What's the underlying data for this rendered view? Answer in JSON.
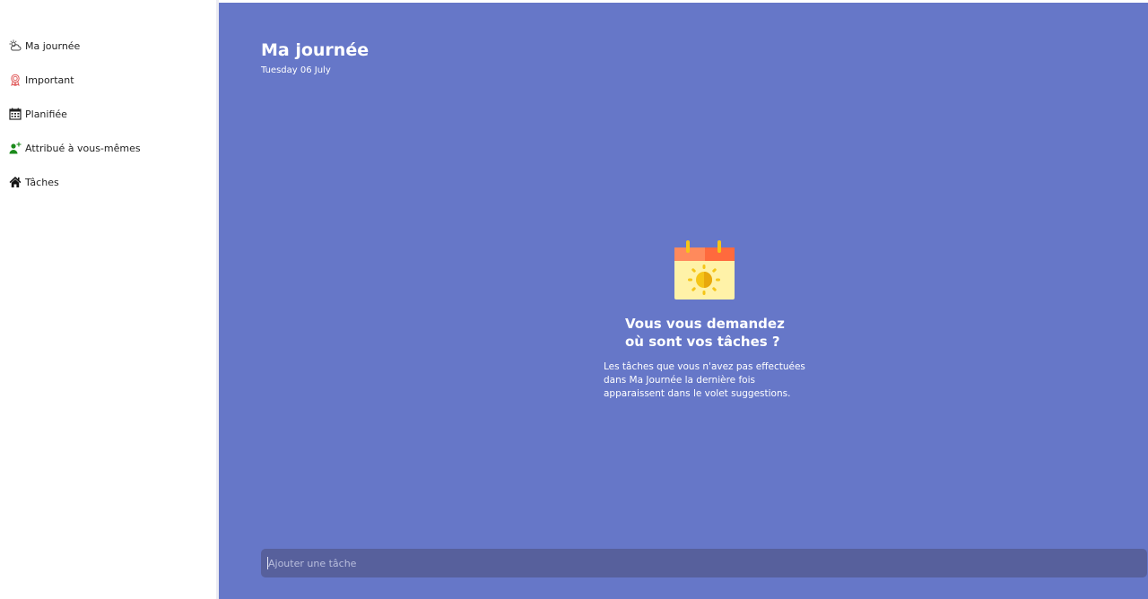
{
  "sidebar": {
    "items": [
      {
        "label": "Ma journée",
        "icon": "sun-cloud-icon",
        "icon_color": "#444444"
      },
      {
        "label": "Important",
        "icon": "award-icon",
        "icon_color": "#e05a5a"
      },
      {
        "label": "Planifiée",
        "icon": "calendar-icon",
        "icon_color": "#222222"
      },
      {
        "label": "Attribué à vous-mêmes",
        "icon": "person-add-icon",
        "icon_color": "#1a8a1a"
      },
      {
        "label": "Tâches",
        "icon": "home-icon",
        "icon_color": "#111111"
      }
    ]
  },
  "main": {
    "title": "Ma journée",
    "date": "Tuesday 06 July",
    "background_color": "#6677c8",
    "empty_state": {
      "illustration": "calendar-sun-icon",
      "heading_line1": "Vous vous demandez",
      "heading_line2": "où sont vos tâches ?",
      "text_line1": "Les tâches que vous n'avez pas effectuées",
      "text_line2": "dans Ma Journée la dernière fois",
      "text_line3": "apparaissent dans le volet suggestions."
    },
    "add_task": {
      "placeholder": "Ajouter une tâche",
      "value": ""
    }
  }
}
